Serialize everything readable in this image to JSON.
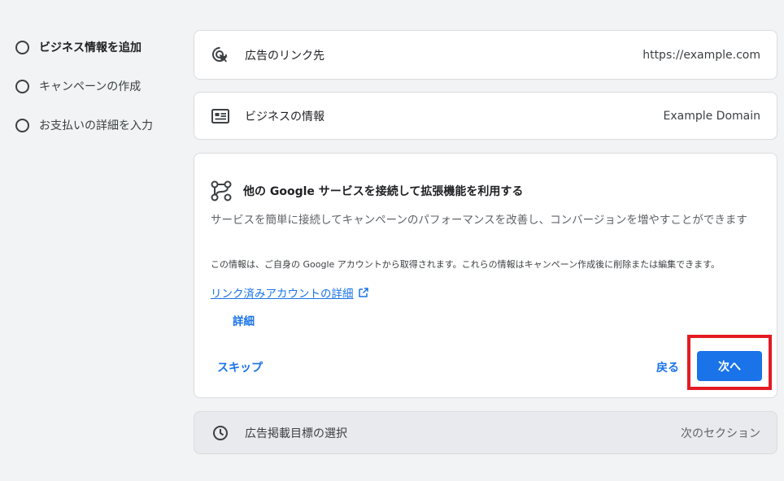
{
  "steps": [
    {
      "label": "ビジネス情報を追加",
      "active": true
    },
    {
      "label": "キャンペーンの作成",
      "active": false
    },
    {
      "label": "お支払いの詳細を入力",
      "active": false
    }
  ],
  "link_card": {
    "title": "広告のリンク先",
    "value": "https://example.com",
    "icon": "cursor-target-icon"
  },
  "business_card": {
    "title": "ビジネスの情報",
    "value": "Example Domain",
    "icon": "business-card-icon"
  },
  "connect_card": {
    "icon": "connection-icon",
    "title": "他の Google サービスを接続して拡張機能を利用する",
    "description": "サービスを簡単に接続してキャンペーンのパフォーマンスを改善し、コンバージョンを増やすことができます",
    "note": "この情報は、ご自身の Google アカウントから取得されます。これらの情報はキャンペーン作成後に削除または編集できます。",
    "link_label": "リンク済みアカウントの詳細",
    "details_label": "詳細",
    "skip_label": "スキップ",
    "back_label": "戻る",
    "next_label": "次へ"
  },
  "goal_card": {
    "title": "広告掲載目標の選択",
    "value": "次のセクション",
    "icon": "clock-icon"
  },
  "colors": {
    "accent": "#1a73e8",
    "highlight": "#e31b23",
    "background": "#f1f3f4"
  }
}
